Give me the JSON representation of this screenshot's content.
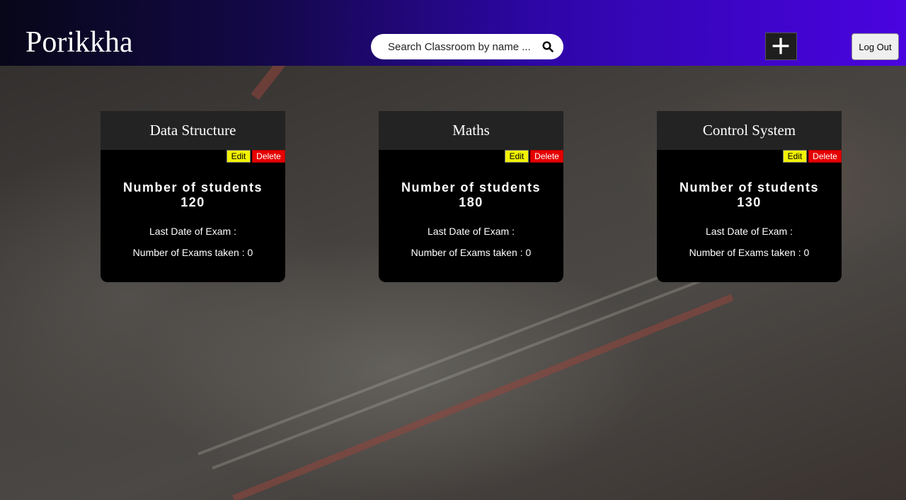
{
  "app": {
    "brand": "Porikkha"
  },
  "header": {
    "search_placeholder": "Search Classroom by name ...",
    "add_icon": "plus-icon",
    "logout_label": "Log Out"
  },
  "classrooms": [
    {
      "name": "Data Structure",
      "edit_label": "Edit",
      "delete_label": "Delete",
      "students_label": "Number of students",
      "students_count": "120",
      "last_exam_label": "Last Date of Exam :",
      "exams_taken_label": "Number of Exams taken : 0"
    },
    {
      "name": "Maths",
      "edit_label": "Edit",
      "delete_label": "Delete",
      "students_label": "Number of students",
      "students_count": "180",
      "last_exam_label": "Last Date of Exam :",
      "exams_taken_label": "Number of Exams taken : 0"
    },
    {
      "name": "Control System",
      "edit_label": "Edit",
      "delete_label": "Delete",
      "students_label": "Number of students",
      "students_count": "130",
      "last_exam_label": "Last Date of Exam :",
      "exams_taken_label": "Number of Exams taken : 0"
    }
  ],
  "colors": {
    "edit": "#f2f200",
    "delete": "#e60000",
    "header_start": "#070718",
    "header_end": "#4a04e0"
  }
}
